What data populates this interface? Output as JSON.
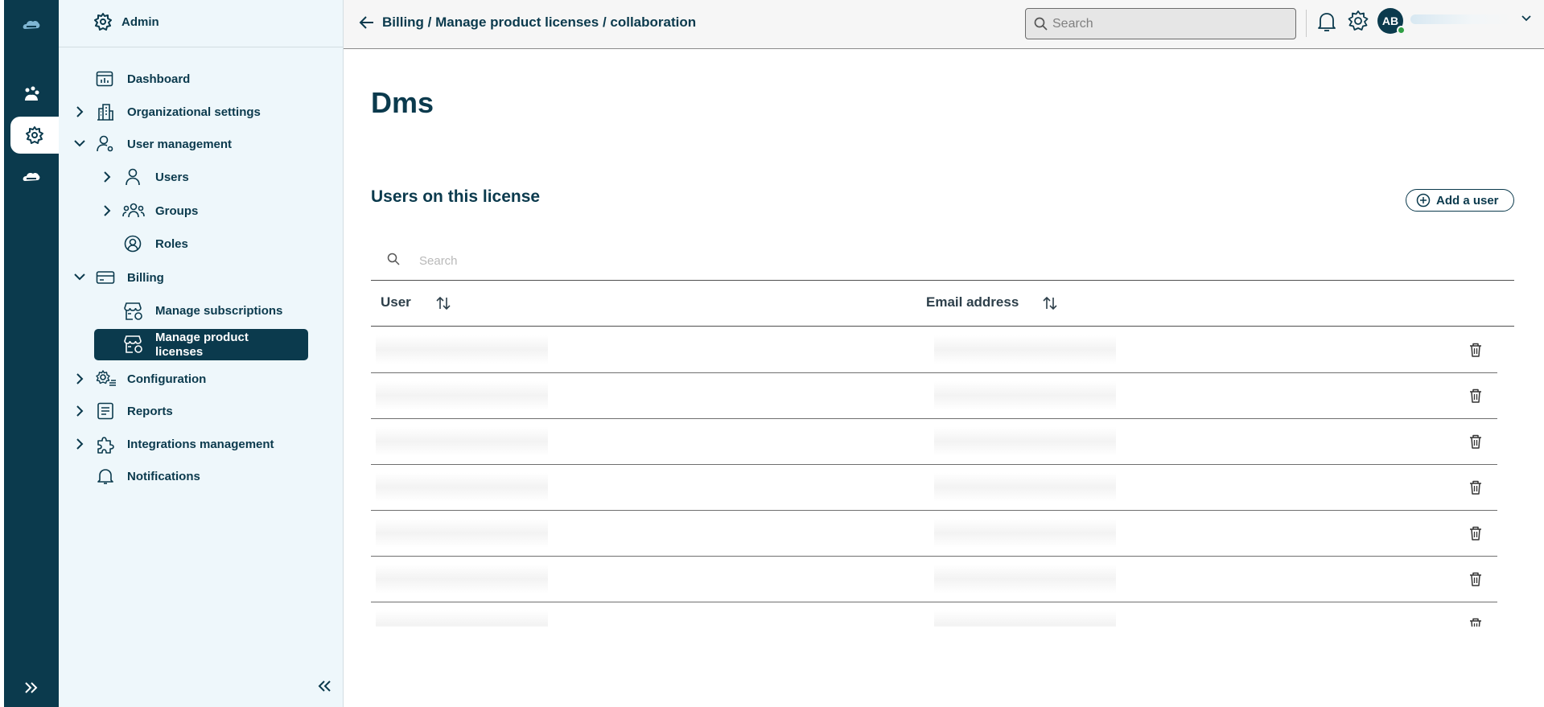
{
  "rail": {
    "items": [
      {
        "icon": "cloud-logo-icon"
      },
      {
        "icon": "dashboard-hub-icon"
      },
      {
        "icon": "gear-icon",
        "active": true
      },
      {
        "icon": "cloud-icon"
      }
    ],
    "expand_icon": "double-chevron-right-icon"
  },
  "sidebar": {
    "header": "Admin",
    "items": [
      {
        "label": "Dashboard"
      },
      {
        "label": "Organizational settings"
      },
      {
        "label": "User management"
      },
      {
        "label": "Users"
      },
      {
        "label": "Groups"
      },
      {
        "label": "Roles"
      },
      {
        "label": "Billing"
      },
      {
        "label": "Manage subscriptions"
      },
      {
        "label": "Manage product licenses",
        "active": true
      },
      {
        "label": "Configuration"
      },
      {
        "label": "Reports"
      },
      {
        "label": "Integrations management"
      },
      {
        "label": "Notifications"
      }
    ]
  },
  "topbar": {
    "breadcrumb": "Billing / Manage product licenses / collaboration",
    "search_placeholder": "Search",
    "avatar_initials": "AB"
  },
  "main": {
    "title": "Dms",
    "section_title": "Users on this license",
    "add_user_label": "Add a user",
    "table_search_placeholder": "Search",
    "columns": [
      "User",
      "Email address"
    ],
    "row_count_visible": 7
  },
  "colors": {
    "primary": "#0b3a4d",
    "sidebar_bg": "#eef7fb",
    "presence": "#2f9e44"
  }
}
